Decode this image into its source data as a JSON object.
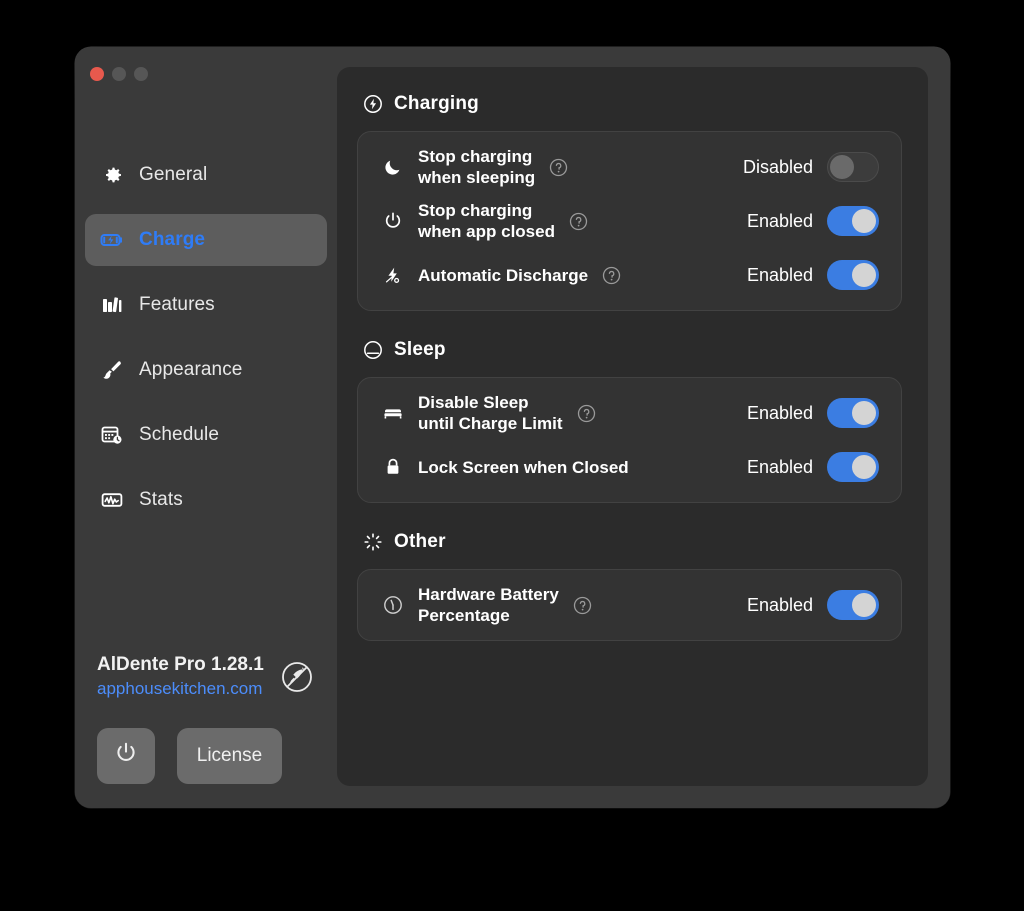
{
  "window": {
    "traffic": {
      "close": "close-button",
      "minimize": "minimize-button",
      "maximize": "maximize-button"
    }
  },
  "sidebar": {
    "items": [
      {
        "id": "general",
        "label": "General",
        "icon": "gear-icon",
        "active": false
      },
      {
        "id": "charge",
        "label": "Charge",
        "icon": "battery-bolt-icon",
        "active": true
      },
      {
        "id": "features",
        "label": "Features",
        "icon": "books-icon",
        "active": false
      },
      {
        "id": "appearance",
        "label": "Appearance",
        "icon": "paintbrush-icon",
        "active": false
      },
      {
        "id": "schedule",
        "label": "Schedule",
        "icon": "calendar-clock-icon",
        "active": false
      },
      {
        "id": "stats",
        "label": "Stats",
        "icon": "waveform-icon",
        "active": false
      }
    ],
    "footer": {
      "version": "AlDente Pro 1.28.1",
      "website": "apphousekitchen.com",
      "rocket_icon": "rocket-circle-icon",
      "power_icon": "power-icon",
      "license_label": "License"
    }
  },
  "main": {
    "sections": [
      {
        "id": "charging",
        "title": "Charging",
        "icon": "bolt-circle-icon",
        "rows": [
          {
            "id": "stop-charging-when-sleeping",
            "label": "Stop charging\nwhen sleeping",
            "icon": "moon-icon",
            "help": "help-icon",
            "state": "Disabled",
            "on": false
          },
          {
            "id": "stop-charging-when-app-closed",
            "label": "Stop charging\nwhen app closed",
            "icon": "power-icon",
            "help": "help-icon",
            "state": "Enabled",
            "on": true
          },
          {
            "id": "automatic-discharge",
            "label": "Automatic Discharge",
            "icon": "bolt-percent-icon",
            "help": "help-icon",
            "state": "Enabled",
            "on": true
          }
        ]
      },
      {
        "id": "sleep",
        "title": "Sleep",
        "icon": "sleep-circle-icon",
        "rows": [
          {
            "id": "disable-sleep-until-charge-limit",
            "label": "Disable Sleep\nuntil Charge Limit",
            "icon": "bed-icon",
            "help": "help-icon",
            "state": "Enabled",
            "on": true
          },
          {
            "id": "lock-screen-when-closed",
            "label": "Lock Screen when Closed",
            "icon": "lock-icon",
            "help": null,
            "state": "Enabled",
            "on": true
          }
        ]
      },
      {
        "id": "other",
        "title": "Other",
        "icon": "spinner-rays-icon",
        "rows": [
          {
            "id": "hardware-battery-percentage",
            "label": "Hardware Battery\nPercentage",
            "icon": "gauge-circle-icon",
            "help": "help-icon",
            "state": "Enabled",
            "on": true
          }
        ]
      }
    ]
  },
  "colors": {
    "accent_blue": "#3b7de2",
    "link_blue": "#4c8dfb",
    "close_red": "#e8594d",
    "sidebar_bg": "#3a3a3a",
    "content_bg": "#2b2b2b",
    "card_bg": "#333333"
  }
}
